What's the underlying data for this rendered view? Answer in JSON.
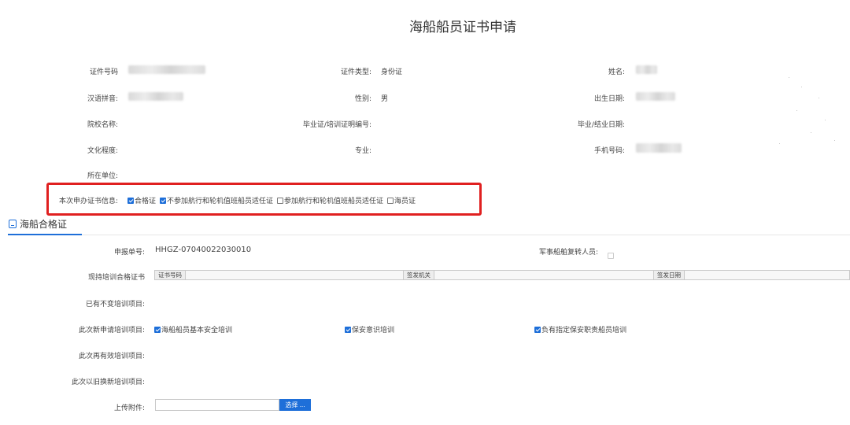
{
  "page_title": "海船船员证书申请",
  "applicant": {
    "id_number_label": "证件号码",
    "id_type_label": "证件类型:",
    "id_type_value": "身份证",
    "name_label": "姓名:",
    "pinyin_label": "汉语拼音:",
    "gender_label": "性别:",
    "gender_value": "男",
    "birth_date_label": "出生日期:",
    "school_label": "院校名称:",
    "grad_cert_label": "毕业证/培训证明编号:",
    "grad_date_label": "毕业/结业日期:",
    "education_label": "文化程度:",
    "major_label": "专业:",
    "phone_label": "手机号码:",
    "employer_label": "所在单位:"
  },
  "cert_info": {
    "label": "本次申办证书信息:",
    "options": [
      {
        "label": "合格证",
        "checked": true
      },
      {
        "label": "不参加航行和轮机值班船员适任证",
        "checked": true
      },
      {
        "label": "参加航行和轮机值班船员适任证",
        "checked": false
      },
      {
        "label": "海员证",
        "checked": false
      }
    ]
  },
  "section": {
    "title": "海船合格证"
  },
  "form": {
    "report_no_label": "申报单号:",
    "report_no_value": "HHGZ-07040022030010",
    "military_label": "军事船舶复转人员:",
    "current_cert_label": "现持培训合格证书",
    "table_headers": [
      "证书号码",
      "签发机关",
      "签发日期"
    ],
    "existing_label": "已有不变培训项目:",
    "new_label": "此次新申请培训项目:",
    "new_items": [
      {
        "label": "海船船员基本安全培训",
        "checked": true
      },
      {
        "label": "保安意识培训",
        "checked": true
      },
      {
        "label": "负有指定保安职责船员培训",
        "checked": true
      }
    ],
    "revalidate_label": "此次再有效培训项目:",
    "renew_label": "此次以旧换新培训项目:",
    "upload_label": "上传附件:",
    "upload_button": "选择 ..."
  },
  "colors": {
    "accent": "#1e6fd9",
    "highlight_box": "#e02020"
  }
}
